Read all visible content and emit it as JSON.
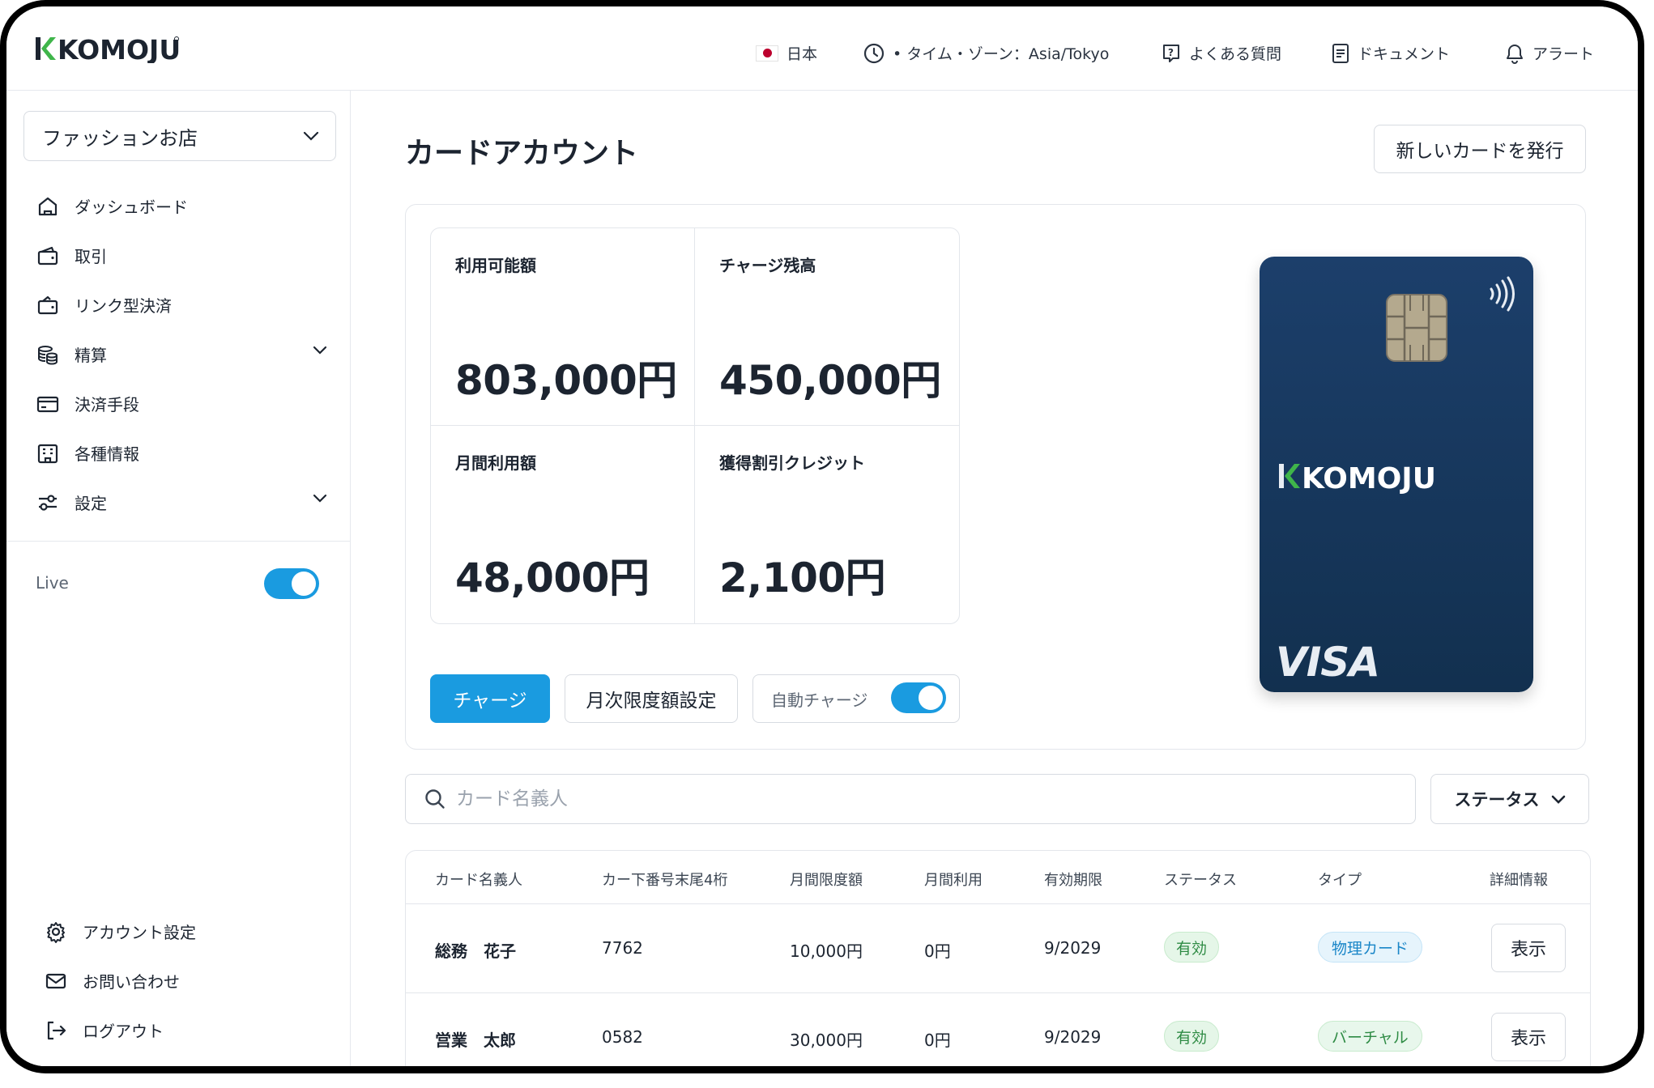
{
  "brand": {
    "name": "KOMOJU",
    "accent": "#1a9be0",
    "logo_green": "#3fb54a"
  },
  "topbar": {
    "country": "日本",
    "timezone": "• タイム・ゾーン：Asia/Tokyo",
    "faq": "よくある質問",
    "docs": "ドキュメント",
    "alerts": "アラート"
  },
  "sidebar": {
    "shop_select": "ファッションお店",
    "items": [
      {
        "label": "ダッシュボード",
        "icon": "home-icon"
      },
      {
        "label": "取引",
        "icon": "wallet-icon"
      },
      {
        "label": "リンク型決済",
        "icon": "wallet-link-icon"
      },
      {
        "label": "精算",
        "icon": "coins-icon",
        "expandable": true
      },
      {
        "label": "決済手段",
        "icon": "credit-card-icon"
      },
      {
        "label": "各種情報",
        "icon": "building-icon"
      },
      {
        "label": "設定",
        "icon": "sliders-icon",
        "expandable": true
      }
    ],
    "live_label": "Live",
    "live_enabled": true,
    "bottom": [
      {
        "label": "アカウント設定",
        "icon": "gear-icon"
      },
      {
        "label": "お問い合わせ",
        "icon": "mail-icon"
      },
      {
        "label": "ログアウト",
        "icon": "logout-icon"
      }
    ]
  },
  "main": {
    "title": "カードアカウント",
    "issue_button": "新しいカードを発行",
    "stats": [
      {
        "label": "利用可能額",
        "value": "803,000円"
      },
      {
        "label": "チャージ残高",
        "value": "450,000円"
      },
      {
        "label": "月間利用額",
        "value": "48,000円"
      },
      {
        "label": "獲得割引クレジット",
        "value": "2,100円"
      }
    ],
    "charge_button": "チャージ",
    "limit_button": "月次限度額設定",
    "auto_charge_label": "自動チャージ",
    "auto_charge_enabled": true,
    "card": {
      "brand": "KOMOJU",
      "network": "VISA"
    },
    "search_placeholder": "カード名義人",
    "status_filter": "ステータス"
  },
  "table": {
    "columns": [
      "カード名義人",
      "カー下番号末尾4桁",
      "月間限度額",
      "月間利用",
      "有効期限",
      "ステータス",
      "タイプ",
      "詳細情報"
    ],
    "rows": [
      {
        "name": "総務　花子",
        "last4": "7762",
        "limit": "10,000円",
        "used": "0円",
        "expiry": "9/2029",
        "status": "有効",
        "type": "物理カード",
        "action": "表示"
      },
      {
        "name": "営業　太郎",
        "last4": "0582",
        "limit": "30,000円",
        "used": "0円",
        "expiry": "9/2029",
        "status": "有効",
        "type": "バーチャル",
        "action": "表示"
      }
    ]
  }
}
